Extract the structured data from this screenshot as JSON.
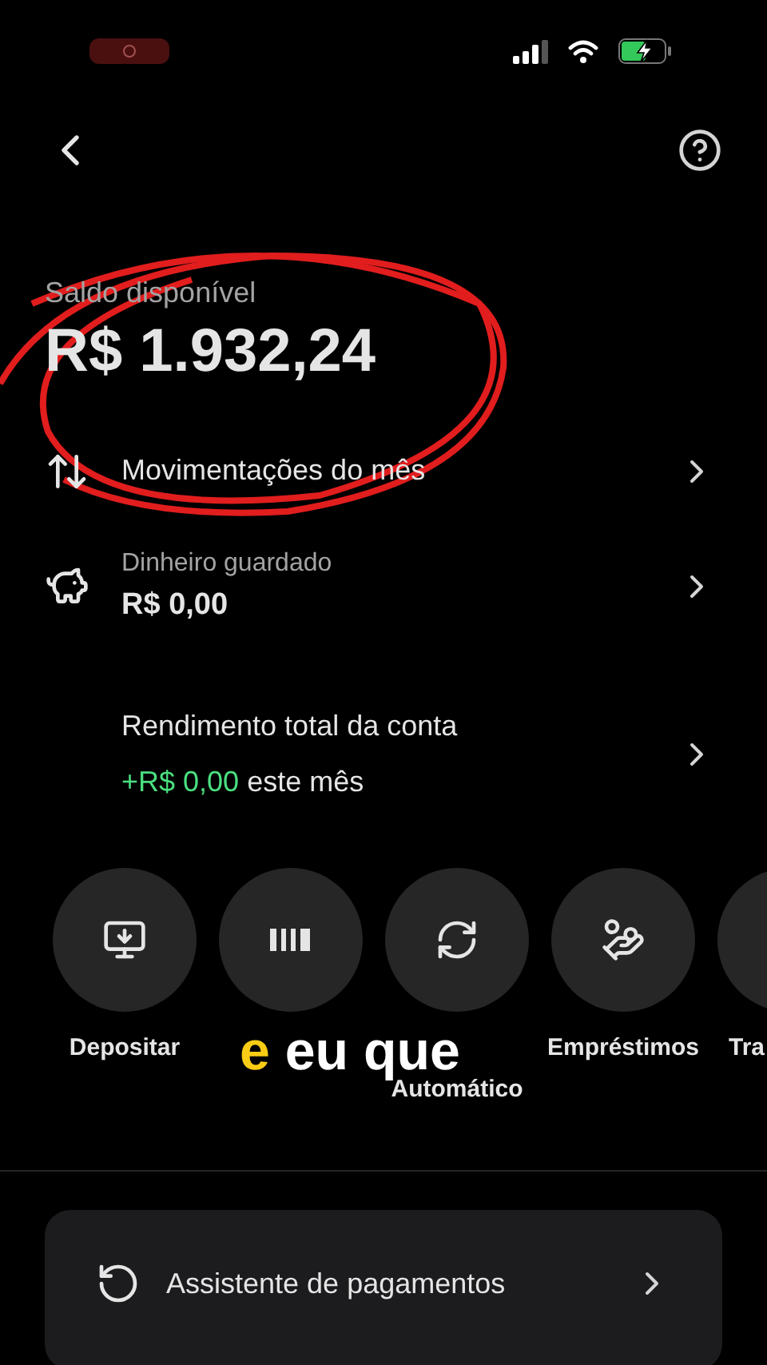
{
  "status_bar": {
    "recording": true,
    "charging": true
  },
  "balance": {
    "label": "Saldo disponível",
    "amount": "R$ 1.932,24"
  },
  "rows": [
    {
      "kind": "moves",
      "title": "Movimentações do mês"
    },
    {
      "kind": "savings",
      "label": "Dinheiro guardado",
      "value": "R$ 0,00"
    },
    {
      "kind": "yield",
      "title": "Rendimento total da conta",
      "gain": "+R$ 0,00",
      "suffix": "este mês"
    }
  ],
  "actions": [
    {
      "kind": "deposit",
      "label": "Depositar"
    },
    {
      "kind": "barcode"
    },
    {
      "kind": "auto",
      "label": "Automático"
    },
    {
      "kind": "loan",
      "label": "Empréstimos"
    },
    {
      "kind": "transfer",
      "label": "Tra"
    }
  ],
  "caption": {
    "highlight": "e",
    "text": "eu que"
  },
  "card": {
    "title": "Assistente de pagamentos"
  }
}
